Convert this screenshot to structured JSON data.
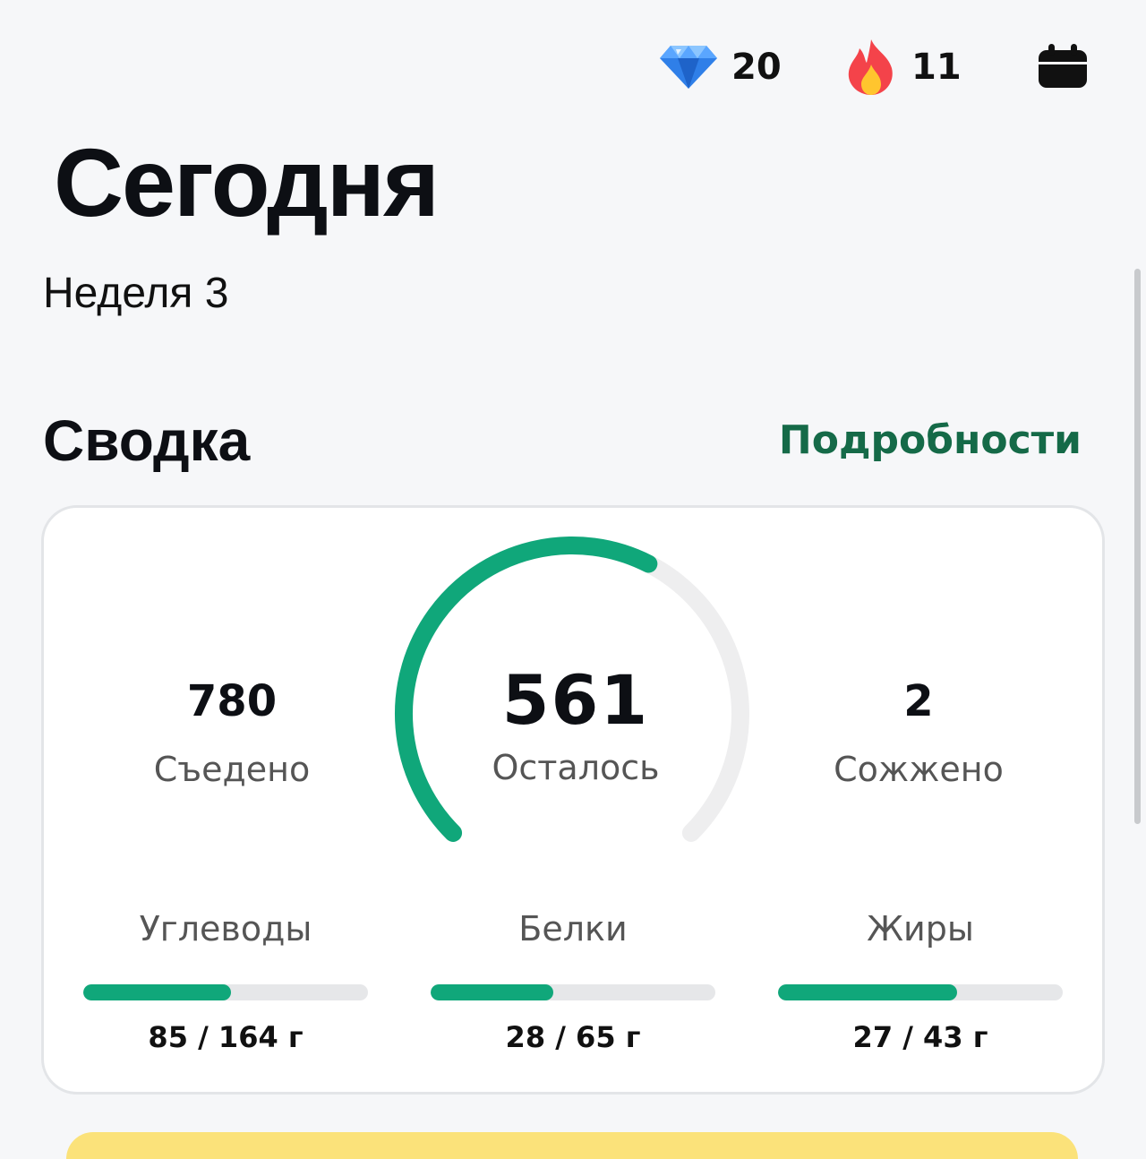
{
  "header": {
    "gems": "20",
    "streak": "11",
    "gem_icon": "gem-icon",
    "fire_icon": "fire-icon",
    "calendar_icon": "calendar-icon"
  },
  "page": {
    "title": "Сегодня",
    "subtitle": "Неделя 3"
  },
  "summary": {
    "heading": "Сводка",
    "details_link": "Подробности",
    "eaten": {
      "value": "780",
      "label": "Съедено"
    },
    "remaining": {
      "value": "561",
      "label": "Осталось"
    },
    "burned": {
      "value": "2",
      "label": "Сожжено"
    },
    "ring_progress": 0.6,
    "macros": [
      {
        "label": "Углеводы",
        "value": "85 / 164 г",
        "progress": 0.518
      },
      {
        "label": "Белки",
        "value": "28 / 65 г",
        "progress": 0.431
      },
      {
        "label": "Жиры",
        "value": "27 / 43 г",
        "progress": 0.628
      }
    ]
  },
  "colors": {
    "accent": "#10a77a",
    "link": "#156a48",
    "track": "#e6e7e9",
    "background": "#f6f7f9"
  }
}
